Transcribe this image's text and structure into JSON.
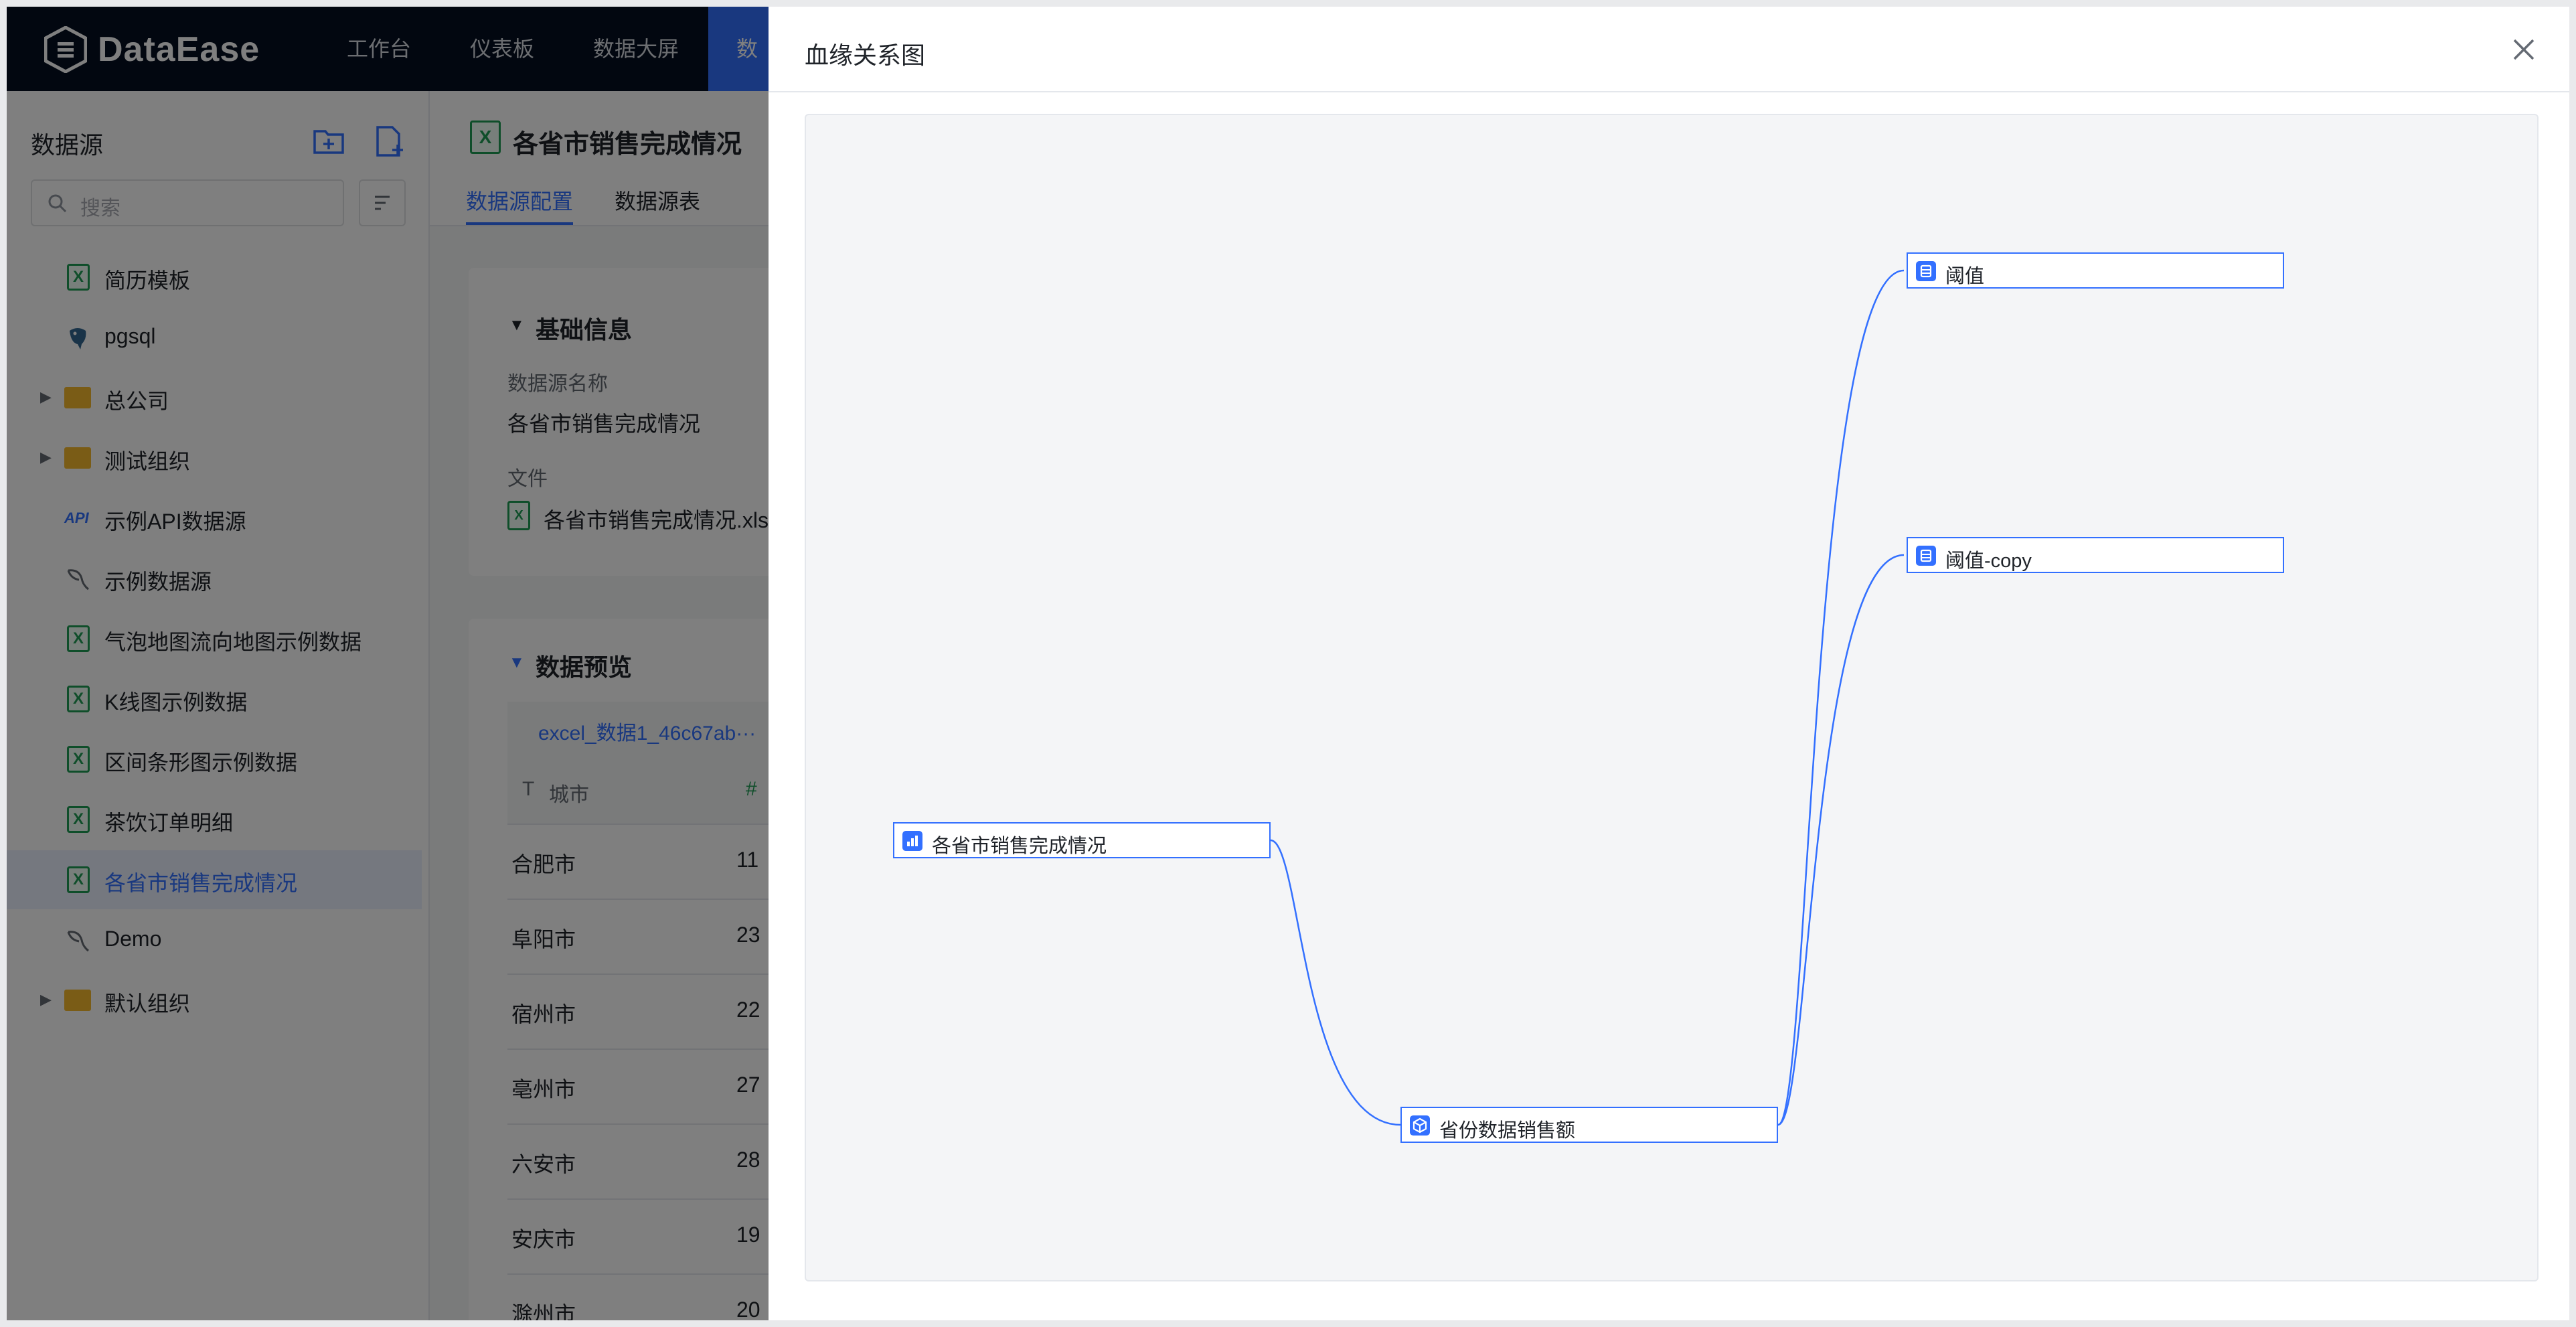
{
  "app": {
    "logo_text": "DataEase",
    "nav": [
      "工作台",
      "仪表板",
      "数据大屏",
      "数"
    ]
  },
  "sidebar": {
    "title": "数据源",
    "search_placeholder": "搜索",
    "items": [
      {
        "label": "简历模板",
        "icon": "excel-icon"
      },
      {
        "label": "pgsql",
        "icon": "postgres-icon"
      },
      {
        "label": "总公司",
        "icon": "folder-icon",
        "expandable": true
      },
      {
        "label": "测试组织",
        "icon": "folder-icon",
        "expandable": true
      },
      {
        "label": "示例API数据源",
        "icon": "api-icon"
      },
      {
        "label": "示例数据源",
        "icon": "mysql-icon"
      },
      {
        "label": "气泡地图流向地图示例数据",
        "icon": "excel-icon"
      },
      {
        "label": "K线图示例数据",
        "icon": "excel-icon"
      },
      {
        "label": "区间条形图示例数据",
        "icon": "excel-icon"
      },
      {
        "label": "茶饮订单明细",
        "icon": "excel-icon"
      },
      {
        "label": "各省市销售完成情况",
        "icon": "excel-icon",
        "selected": true
      },
      {
        "label": "Demo",
        "icon": "mysql-icon"
      },
      {
        "label": "默认组织",
        "icon": "folder-icon",
        "expandable": true
      }
    ]
  },
  "main": {
    "title": "各省市销售完成情况",
    "tabs": [
      "数据源配置",
      "数据源表"
    ],
    "basic": {
      "section_title": "基础信息",
      "name_label": "数据源名称",
      "name_value": "各省市销售完成情况",
      "file_label": "文件",
      "file_value": "各省市销售完成情况.xls"
    },
    "preview": {
      "section_title": "数据预览",
      "table_tab": "excel_数据1_46c67ab···",
      "col1": "城市",
      "col2_prefix": "#",
      "rows": [
        {
          "city": "合肥市",
          "val": "11"
        },
        {
          "city": "阜阳市",
          "val": "23"
        },
        {
          "city": "宿州市",
          "val": "22"
        },
        {
          "city": "亳州市",
          "val": "27"
        },
        {
          "city": "六安市",
          "val": "28"
        },
        {
          "city": "安庆市",
          "val": "19"
        },
        {
          "city": "滁州市",
          "val": "20"
        }
      ]
    }
  },
  "drawer": {
    "title": "血缘关系图",
    "nodes": [
      {
        "id": "ds",
        "label": "各省市销售完成情况",
        "kind": "datasource"
      },
      {
        "id": "dataset",
        "label": "省份数据销售额",
        "kind": "dataset"
      },
      {
        "id": "v1",
        "label": "阈值",
        "kind": "dashboard"
      },
      {
        "id": "v2",
        "label": "阈值-copy",
        "kind": "dashboard"
      }
    ],
    "edges": [
      [
        "ds",
        "dataset"
      ],
      [
        "dataset",
        "v1"
      ],
      [
        "dataset",
        "v2"
      ]
    ]
  },
  "colors": {
    "accent": "#3370ff",
    "nav_bg": "#050e21",
    "excel_green": "#1f9d55",
    "folder_yellow": "#f5b92d"
  }
}
